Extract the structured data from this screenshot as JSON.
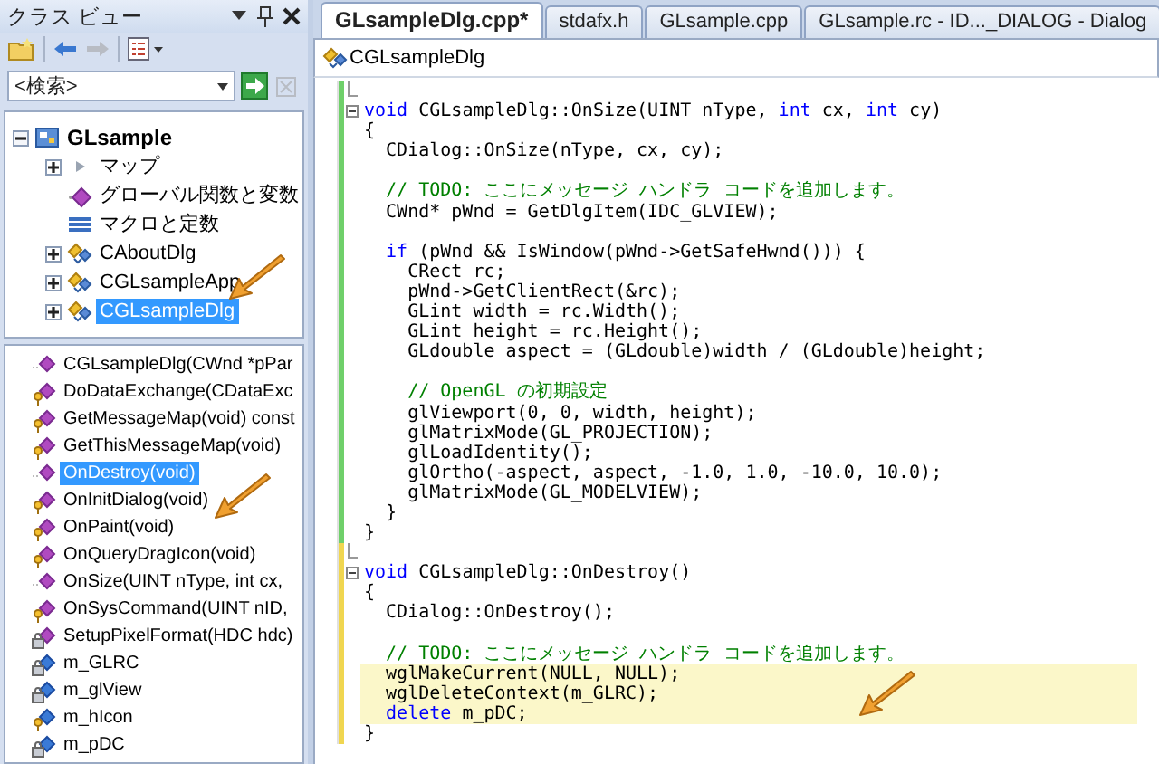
{
  "class_view": {
    "title": "クラス ビュー",
    "toolbar": [
      {
        "kind": "new-folder",
        "disabled": false
      },
      {
        "kind": "back",
        "disabled": false
      },
      {
        "kind": "forward",
        "disabled": true
      },
      {
        "kind": "settings",
        "disabled": false
      }
    ],
    "search": {
      "placeholder": "<検索>",
      "clear_disabled": true
    },
    "tree": [
      {
        "label": "GLsample",
        "kind": "project",
        "expandable": true,
        "expanded": true,
        "selected": false,
        "children": [
          {
            "label": "マップ",
            "kind": "map",
            "expandable": true,
            "expanded": false,
            "selected": false
          },
          {
            "label": "グローバル関数と変数",
            "kind": "globals",
            "expandable": false,
            "selected": false
          },
          {
            "label": "マクロと定数",
            "kind": "macros",
            "expandable": false,
            "selected": false
          },
          {
            "label": "CAboutDlg",
            "kind": "class",
            "expandable": true,
            "expanded": false,
            "selected": false
          },
          {
            "label": "CGLsampleApp",
            "kind": "class",
            "expandable": true,
            "expanded": false,
            "selected": false
          },
          {
            "label": "CGLsampleDlg",
            "kind": "class",
            "expandable": true,
            "expanded": false,
            "selected": true
          }
        ]
      }
    ],
    "members": [
      {
        "label": "CGLsampleDlg(CWnd *pPar",
        "kind": "public-method",
        "selected": false
      },
      {
        "label": "DoDataExchange(CDataExc",
        "kind": "protected-method",
        "selected": false
      },
      {
        "label": "GetMessageMap(void) const",
        "kind": "protected-method",
        "selected": false
      },
      {
        "label": "GetThisMessageMap(void)",
        "kind": "protected-method",
        "selected": false
      },
      {
        "label": "OnDestroy(void)",
        "kind": "public-method",
        "selected": true
      },
      {
        "label": "OnInitDialog(void)",
        "kind": "protected-method",
        "selected": false
      },
      {
        "label": "OnPaint(void)",
        "kind": "protected-method",
        "selected": false
      },
      {
        "label": "OnQueryDragIcon(void)",
        "kind": "protected-method",
        "selected": false
      },
      {
        "label": "OnSize(UINT nType, int cx,",
        "kind": "public-method",
        "selected": false
      },
      {
        "label": "OnSysCommand(UINT nID,",
        "kind": "protected-method",
        "selected": false
      },
      {
        "label": "SetupPixelFormat(HDC hdc)",
        "kind": "private-method",
        "selected": false
      },
      {
        "label": "m_GLRC",
        "kind": "private-field",
        "selected": false
      },
      {
        "label": "m_glView",
        "kind": "private-field",
        "selected": false
      },
      {
        "label": "m_hIcon",
        "kind": "protected-field",
        "selected": false
      },
      {
        "label": "m_pDC",
        "kind": "private-field",
        "selected": false
      }
    ]
  },
  "editor": {
    "tabs": [
      {
        "label": "GLsampleDlg.cpp*",
        "selected": true
      },
      {
        "label": "stdafx.h",
        "selected": false
      },
      {
        "label": "GLsample.cpp",
        "selected": false
      },
      {
        "label": "GLsample.rc - ID..._DIALOG - Dialog",
        "selected": false
      }
    ],
    "scope": "CGLsampleDlg",
    "lines": [
      {
        "modified": false,
        "fold_start": false,
        "fold_end": true,
        "highlighted": false
      },
      {
        "segments": [
          {
            "kind": "keyword",
            "text": "void"
          },
          {
            "kind": "plain",
            "text": " CGLsampleDlg::OnSize(UINT nType, "
          },
          {
            "kind": "keyword",
            "text": "int"
          },
          {
            "kind": "plain",
            "text": " cx, "
          },
          {
            "kind": "keyword",
            "text": "int"
          },
          {
            "kind": "plain",
            "text": " cy)"
          }
        ],
        "modified": false,
        "fold_start": true,
        "fold_end": false,
        "highlighted": false
      },
      {
        "segments": [
          {
            "kind": "plain",
            "text": "{"
          }
        ],
        "modified": false,
        "fold_start": false,
        "fold_end": false,
        "highlighted": false
      },
      {
        "segments": [
          {
            "kind": "plain",
            "text": "  CDialog::OnSize(nType, cx, cy);"
          }
        ],
        "modified": false,
        "fold_start": false,
        "fold_end": false,
        "highlighted": false
      },
      {
        "modified": false,
        "fold_start": false,
        "fold_end": false,
        "highlighted": false
      },
      {
        "segments": [
          {
            "kind": "comment",
            "text": "  // TODO: ここにメッセージ ハンドラ コードを追加します。"
          }
        ],
        "modified": false,
        "fold_start": false,
        "fold_end": false,
        "highlighted": false
      },
      {
        "segments": [
          {
            "kind": "plain",
            "text": "  CWnd* pWnd = GetDlgItem(IDC_GLVIEW);"
          }
        ],
        "modified": false,
        "fold_start": false,
        "fold_end": false,
        "highlighted": false
      },
      {
        "modified": false,
        "fold_start": false,
        "fold_end": false,
        "highlighted": false
      },
      {
        "segments": [
          {
            "kind": "keyword",
            "text": "  if"
          },
          {
            "kind": "plain",
            "text": " (pWnd && IsWindow(pWnd->GetSafeHwnd())) {"
          }
        ],
        "modified": false,
        "fold_start": false,
        "fold_end": false,
        "highlighted": false
      },
      {
        "segments": [
          {
            "kind": "plain",
            "text": "    CRect rc;"
          }
        ],
        "modified": false,
        "fold_start": false,
        "fold_end": false,
        "highlighted": false
      },
      {
        "segments": [
          {
            "kind": "plain",
            "text": "    pWnd->GetClientRect(&rc);"
          }
        ],
        "modified": false,
        "fold_start": false,
        "fold_end": false,
        "highlighted": false
      },
      {
        "segments": [
          {
            "kind": "plain",
            "text": "    GLint width = rc.Width();"
          }
        ],
        "modified": false,
        "fold_start": false,
        "fold_end": false,
        "highlighted": false
      },
      {
        "segments": [
          {
            "kind": "plain",
            "text": "    GLint height = rc.Height();"
          }
        ],
        "modified": false,
        "fold_start": false,
        "fold_end": false,
        "highlighted": false
      },
      {
        "segments": [
          {
            "kind": "plain",
            "text": "    GLdouble aspect = (GLdouble)width / (GLdouble)height;"
          }
        ],
        "modified": false,
        "fold_start": false,
        "fold_end": false,
        "highlighted": false
      },
      {
        "modified": false,
        "fold_start": false,
        "fold_end": false,
        "highlighted": false
      },
      {
        "segments": [
          {
            "kind": "comment",
            "text": "    // OpenGL の初期設定"
          }
        ],
        "modified": false,
        "fold_start": false,
        "fold_end": false,
        "highlighted": false
      },
      {
        "segments": [
          {
            "kind": "plain",
            "text": "    glViewport(0, 0, width, height);"
          }
        ],
        "modified": false,
        "fold_start": false,
        "fold_end": false,
        "highlighted": false
      },
      {
        "segments": [
          {
            "kind": "plain",
            "text": "    glMatrixMode(GL_PROJECTION);"
          }
        ],
        "modified": false,
        "fold_start": false,
        "fold_end": false,
        "highlighted": false
      },
      {
        "segments": [
          {
            "kind": "plain",
            "text": "    glLoadIdentity();"
          }
        ],
        "modified": false,
        "fold_start": false,
        "fold_end": false,
        "highlighted": false
      },
      {
        "segments": [
          {
            "kind": "plain",
            "text": "    glOrtho(-aspect, aspect, -1.0, 1.0, -10.0, 10.0);"
          }
        ],
        "modified": false,
        "fold_start": false,
        "fold_end": false,
        "highlighted": false
      },
      {
        "segments": [
          {
            "kind": "plain",
            "text": "    glMatrixMode(GL_MODELVIEW);"
          }
        ],
        "modified": false,
        "fold_start": false,
        "fold_end": false,
        "highlighted": false
      },
      {
        "segments": [
          {
            "kind": "plain",
            "text": "  }"
          }
        ],
        "modified": false,
        "fold_start": false,
        "fold_end": false,
        "highlighted": false
      },
      {
        "segments": [
          {
            "kind": "plain",
            "text": "}"
          }
        ],
        "modified": false,
        "fold_start": false,
        "fold_end": false,
        "highlighted": false
      },
      {
        "modified": true,
        "fold_start": false,
        "fold_end": true,
        "highlighted": false
      },
      {
        "segments": [
          {
            "kind": "keyword",
            "text": "void"
          },
          {
            "kind": "plain",
            "text": " CGLsampleDlg::OnDestroy()"
          }
        ],
        "modified": true,
        "fold_start": true,
        "fold_end": false,
        "highlighted": false
      },
      {
        "segments": [
          {
            "kind": "plain",
            "text": "{"
          }
        ],
        "modified": true,
        "fold_start": false,
        "fold_end": false,
        "highlighted": false
      },
      {
        "segments": [
          {
            "kind": "plain",
            "text": "  CDialog::OnDestroy();"
          }
        ],
        "modified": true,
        "fold_start": false,
        "fold_end": false,
        "highlighted": false
      },
      {
        "modified": true,
        "fold_start": false,
        "fold_end": false,
        "highlighted": false
      },
      {
        "segments": [
          {
            "kind": "comment",
            "text": "  // TODO: ここにメッセージ ハンドラ コードを追加します。"
          }
        ],
        "modified": true,
        "fold_start": false,
        "fold_end": false,
        "highlighted": false
      },
      {
        "segments": [
          {
            "kind": "plain",
            "text": "  wglMakeCurrent(NULL, NULL);"
          }
        ],
        "modified": true,
        "fold_start": false,
        "fold_end": false,
        "highlighted": true
      },
      {
        "segments": [
          {
            "kind": "plain",
            "text": "  wglDeleteContext(m_GLRC);"
          }
        ],
        "modified": true,
        "fold_start": false,
        "fold_end": false,
        "highlighted": true
      },
      {
        "segments": [
          {
            "kind": "keyword",
            "text": "  delete"
          },
          {
            "kind": "plain",
            "text": " m_pDC;"
          }
        ],
        "modified": true,
        "fold_start": false,
        "fold_end": false,
        "highlighted": true
      },
      {
        "segments": [
          {
            "kind": "plain",
            "text": "}"
          }
        ],
        "modified": true,
        "fold_start": false,
        "fold_end": false,
        "highlighted": false
      }
    ]
  }
}
